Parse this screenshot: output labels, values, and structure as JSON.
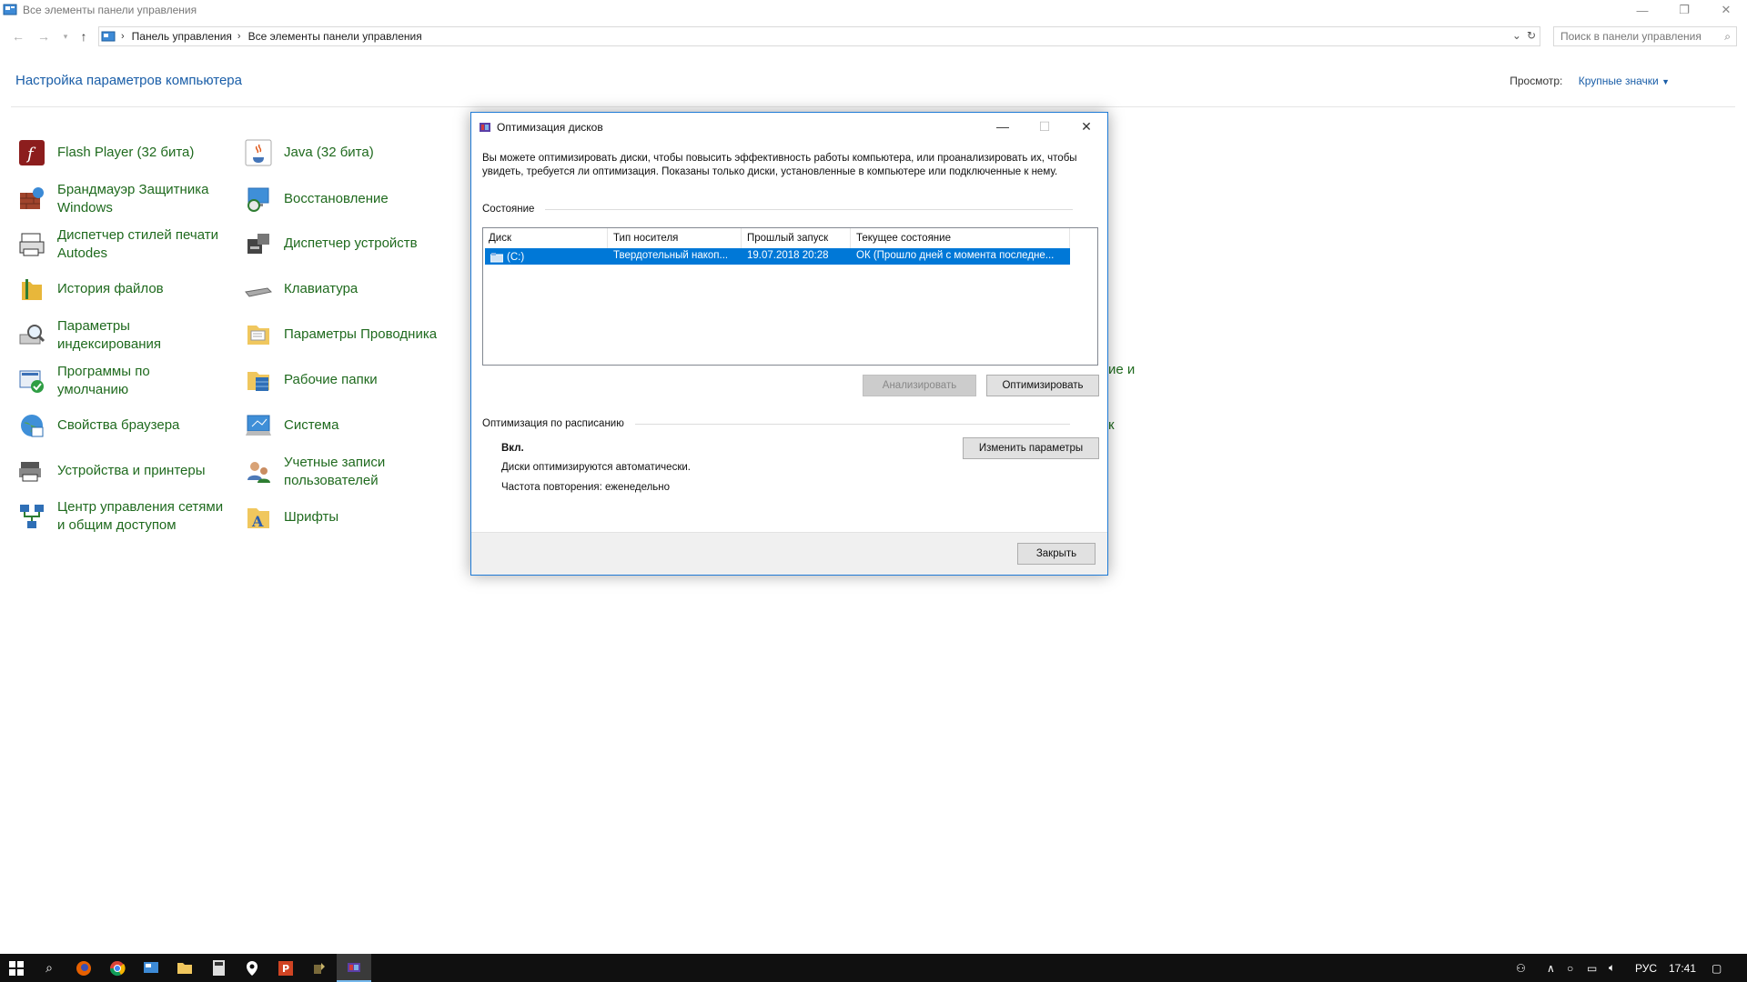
{
  "window": {
    "title": "Все элементы панели управления"
  },
  "address": {
    "crumbs": [
      "Панель управления",
      "Все элементы панели управления"
    ]
  },
  "search": {
    "placeholder": "Поиск в панели управления"
  },
  "heading": "Настройка параметров компьютера",
  "view": {
    "label": "Просмотр:",
    "value": "Крупные значки"
  },
  "items_col1": [
    {
      "label": "Flash Player (32 бита)",
      "icon": "flash-icon"
    },
    {
      "label": "Брандмауэр Защитника Windows",
      "icon": "firewall-icon"
    },
    {
      "label": "Диспетчер стилей печати Autodes",
      "icon": "printer-style-icon"
    },
    {
      "label": "История файлов",
      "icon": "file-history-icon"
    },
    {
      "label": "Параметры индексирования",
      "icon": "indexing-icon"
    },
    {
      "label": "Программы по умолчанию",
      "icon": "default-programs-icon"
    },
    {
      "label": "Свойства браузера",
      "icon": "browser-icon"
    },
    {
      "label": "Устройства и принтеры",
      "icon": "devices-printers-icon"
    },
    {
      "label": "Центр управления сетями и общим доступом",
      "icon": "network-center-icon"
    }
  ],
  "items_col2": [
    {
      "label": "Java (32 бита)",
      "icon": "java-icon"
    },
    {
      "label": "Восстановление",
      "icon": "recovery-icon"
    },
    {
      "label": "Диспетчер устройств",
      "icon": "device-manager-icon"
    },
    {
      "label": "Клавиатура",
      "icon": "keyboard-icon"
    },
    {
      "label": "Параметры Проводника",
      "icon": "explorer-options-icon"
    },
    {
      "label": "Рабочие папки",
      "icon": "work-folders-icon"
    },
    {
      "label": "Система",
      "icon": "system-icon"
    },
    {
      "label": "Учетные записи пользователей",
      "icon": "user-accounts-icon"
    },
    {
      "label": "Шрифты",
      "icon": "fonts-icon"
    }
  ],
  "peek": {
    "a": "ие и",
    "b": "к"
  },
  "dialog": {
    "title": "Оптимизация дисков",
    "description": "Вы можете оптимизировать диски, чтобы повысить эффективность работы  компьютера, или проанализировать их, чтобы увидеть, требуется ли оптимизация. Показаны только диски, установленные в компьютере или подключенные к нему.",
    "status_label": "Состояние",
    "columns": [
      "Диск",
      "Тип носителя",
      "Прошлый запуск",
      "Текущее состояние"
    ],
    "rows": [
      {
        "disk": "(C:)",
        "media": "Твердотельный накоп...",
        "last_run": "19.07.2018 20:28",
        "state": "ОК (Прошло дней с момента последне..."
      }
    ],
    "analyze_btn": "Анализировать",
    "optimize_btn": "Оптимизировать",
    "schedule_label": "Оптимизация по расписанию",
    "schedule_state": "Вкл.",
    "schedule_line1": "Диски оптимизируются автоматически.",
    "schedule_line2": "Частота повторения: еженедельно",
    "change_btn": "Изменить параметры",
    "close_btn": "Закрыть"
  },
  "taskbar": {
    "lang": "РУС",
    "time": "17:41"
  }
}
